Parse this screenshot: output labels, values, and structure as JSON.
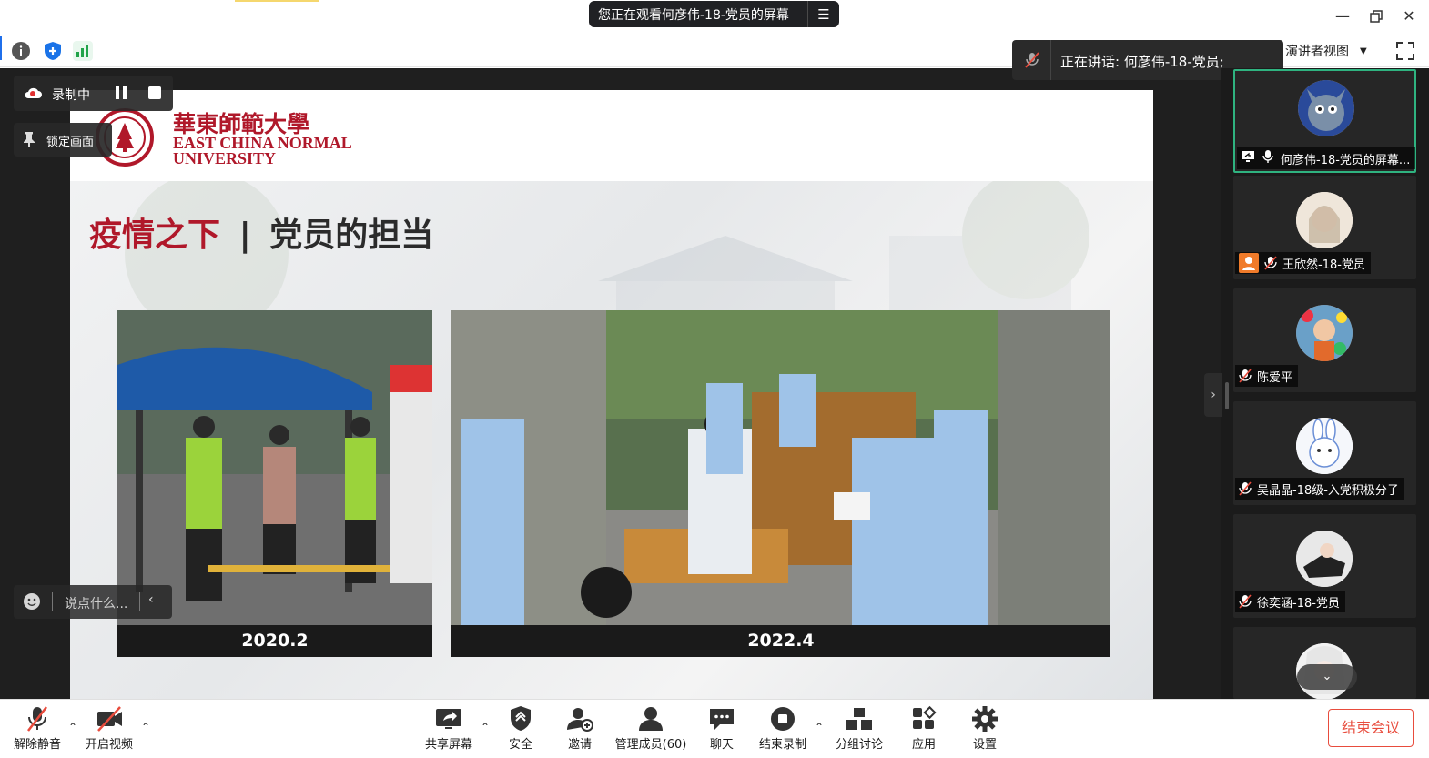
{
  "window": {
    "title": "您正在观看何彦伟-18-党员的屏幕"
  },
  "toolbar": {
    "presenter_view": "演讲者视图",
    "speaking": "正在讲话: 何彦伟-18-党员;"
  },
  "overlay": {
    "recording": "录制中",
    "lock_screen": "锁定画面",
    "chat_placeholder": "说点什么..."
  },
  "slide": {
    "university_cn": "華東師範大學",
    "university_en_1": "EAST CHINA NORMAL",
    "university_en_2": "UNIVERSITY",
    "title_red": "疫情之下",
    "title_sep": "|",
    "title_dark": "党员的担当",
    "photos": [
      {
        "caption": "2020.2"
      },
      {
        "caption": "2022.4"
      }
    ]
  },
  "participants": [
    {
      "name": "何彦伟-18-党员的屏幕...",
      "active": true
    },
    {
      "name": "王欣然-18-党员"
    },
    {
      "name": "陈爱平"
    },
    {
      "name": "吴晶晶-18级-入党积极分子"
    },
    {
      "name": "徐奕涵-18-党员"
    }
  ],
  "bottombar": {
    "unmute": "解除静音",
    "start_video": "开启视频",
    "share_screen": "共享屏幕",
    "security": "安全",
    "invite": "邀请",
    "manage_members": "管理成员(60)",
    "chat": "聊天",
    "stop_recording": "结束录制",
    "breakout": "分组讨论",
    "apps": "应用",
    "settings": "设置",
    "end_meeting": "结束会议"
  },
  "colors": {
    "accent_red": "#b0182a",
    "active_border": "#2fb380",
    "end_meeting": "#e84c3d"
  }
}
